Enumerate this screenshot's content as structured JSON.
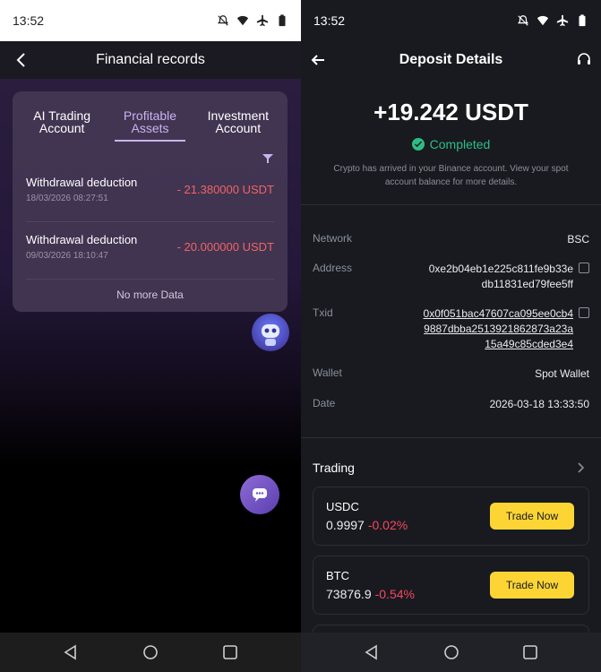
{
  "left": {
    "status_time": "13:52",
    "header_title": "Financial records",
    "tabs": [
      {
        "label": "AI Trading Account"
      },
      {
        "label": "Profitable Assets"
      },
      {
        "label": "Investment Account"
      }
    ],
    "records": [
      {
        "title": "Withdrawal deduction",
        "date": "18/03/2026 08:27:51",
        "amount": "- 21.380000 USDT"
      },
      {
        "title": "Withdrawal deduction",
        "date": "09/03/2026 18:10:47",
        "amount": "- 20.000000 USDT"
      }
    ],
    "no_more": "No more Data"
  },
  "right": {
    "status_time": "13:52",
    "header_title": "Deposit Details",
    "amount": "+19.242 USDT",
    "status": "Completed",
    "description": "Crypto has arrived in your Binance account. View your spot account balance for more details.",
    "details": {
      "network_label": "Network",
      "network_value": "BSC",
      "address_label": "Address",
      "address_line1": "0xe2b04eb1e225c811fe9b33e",
      "address_line2": "db11831ed79fee5ff",
      "txid_label": "Txid",
      "txid_line1": "0x0f051bac47607ca095ee0cb4",
      "txid_line2": "9887dbba2513921862873a23a",
      "txid_line3": "15a49c85cded3e4",
      "wallet_label": "Wallet",
      "wallet_value": "Spot Wallet",
      "date_label": "Date",
      "date_value": "2026-03-18 13:33:50"
    },
    "trading_title": "Trading",
    "coins": [
      {
        "symbol": "USDC",
        "price": "0.9997",
        "change": "-0.02%",
        "button": "Trade Now"
      },
      {
        "symbol": "BTC",
        "price": "73876.9",
        "change": "-0.54%",
        "button": "Trade Now"
      }
    ]
  },
  "colors": {
    "accent_yellow": "#fcd535",
    "loss_red": "#f6465d",
    "success_green": "#2ebd85",
    "tab_active": "#c7b4ef"
  }
}
